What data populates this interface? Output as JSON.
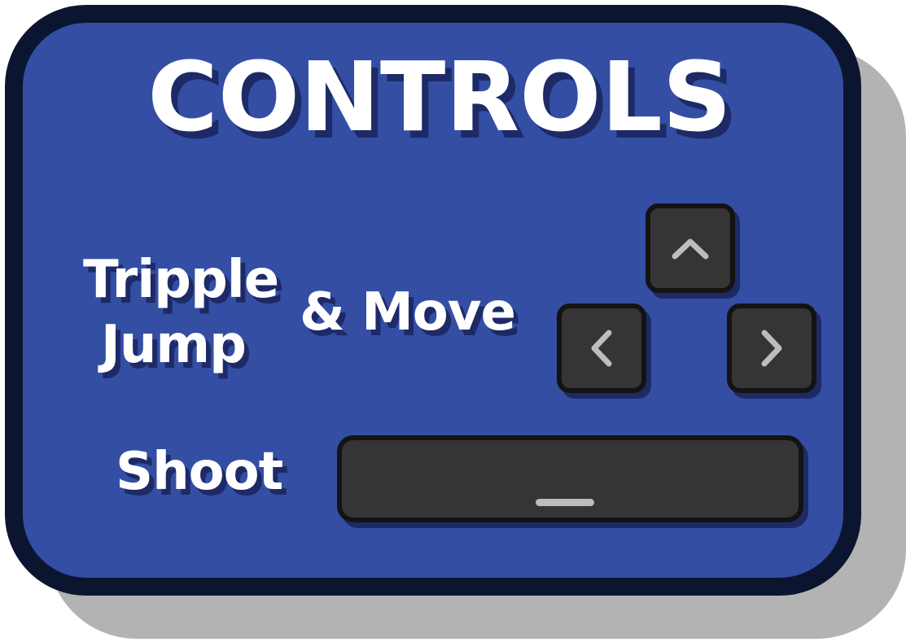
{
  "title": "CONTROLS",
  "rows": {
    "jump": {
      "label_line1": "Tripple",
      "label_line2": "Jump"
    },
    "move": {
      "label": "& Move"
    },
    "shoot": {
      "label": "Shoot"
    }
  },
  "keys": {
    "up": {
      "icon": "chevron-up-icon"
    },
    "left": {
      "icon": "chevron-left-icon"
    },
    "right": {
      "icon": "chevron-right-icon"
    },
    "space": {
      "icon": "spacebar-icon"
    }
  },
  "colors": {
    "panel": "#334ea3",
    "border": "#0c1530",
    "shadow": "#b3b3b3",
    "text_shadow": "#1d2a66",
    "key": "#353535",
    "key_border": "#131313",
    "key_glyph": "#bdbdbd",
    "text": "#ffffff"
  }
}
